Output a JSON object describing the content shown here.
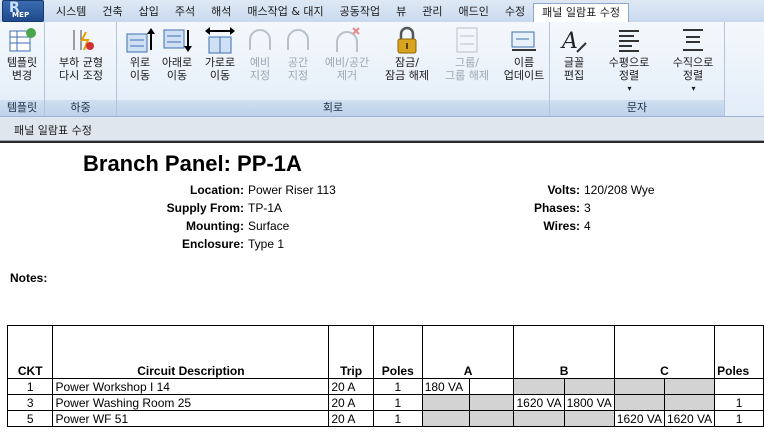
{
  "app": {
    "logo_letter": "R",
    "logo_text": "MEP"
  },
  "tabs": [
    "시스템",
    "건축",
    "삽입",
    "주석",
    "해석",
    "매스작업 & 대지",
    "공동작업",
    "뷰",
    "관리",
    "애드인",
    "수정",
    "패널 일람표 수정"
  ],
  "active_tab_index": 11,
  "ribbon": {
    "panels": [
      {
        "label": "템플릿",
        "buttons": [
          {
            "line1": "템플릿",
            "line2": "변경",
            "icon": "template-change-icon",
            "enabled": true
          }
        ]
      },
      {
        "label": "하중",
        "buttons": [
          {
            "line1": "부하 균형",
            "line2": "다시 조정",
            "icon": "rebalance-loads-icon",
            "enabled": true
          }
        ]
      },
      {
        "label": "회로",
        "buttons": [
          {
            "line1": "위로",
            "line2": "이동",
            "icon": "move-up-icon",
            "enabled": true
          },
          {
            "line1": "아래로",
            "line2": "이동",
            "icon": "move-down-icon",
            "enabled": true
          },
          {
            "line1": "가로로",
            "line2": "이동",
            "icon": "move-across-icon",
            "enabled": true
          },
          {
            "line1": "예비",
            "line2": "지정",
            "icon": "assign-spare-icon",
            "enabled": false
          },
          {
            "line1": "공간",
            "line2": "지정",
            "icon": "assign-space-icon",
            "enabled": false
          },
          {
            "line1": "예비/공간",
            "line2": "제거",
            "icon": "remove-spare-space-icon",
            "enabled": false
          },
          {
            "line1": "잠금/",
            "line2": "잠금 해제",
            "icon": "lock-icon",
            "enabled": true
          },
          {
            "line1": "그룹/",
            "line2": "그룹 해제",
            "icon": "group-icon",
            "enabled": false
          },
          {
            "line1": "이름",
            "line2": "업데이트",
            "icon": "update-names-icon",
            "enabled": true
          }
        ]
      },
      {
        "label": "문자",
        "buttons": [
          {
            "line1": "글꼴",
            "line2": "편집",
            "icon": "font-edit-icon",
            "enabled": true
          },
          {
            "line1": "수평으로",
            "line2": "정렬",
            "icon": "align-horizontal-icon",
            "enabled": true,
            "dropdown": "▾"
          },
          {
            "line1": "수직으로",
            "line2": "정렬",
            "icon": "align-vertical-icon",
            "enabled": true,
            "dropdown": "▾"
          }
        ]
      }
    ]
  },
  "context_title": "패널 일람표 수정",
  "schedule": {
    "title": "Branch Panel: PP-1A",
    "left_fields": [
      {
        "label": "Location:",
        "value": "Power Riser 113"
      },
      {
        "label": "Supply From:",
        "value": "TP-1A"
      },
      {
        "label": "Mounting:",
        "value": "Surface"
      },
      {
        "label": "Enclosure:",
        "value": "Type 1"
      }
    ],
    "right_fields": [
      {
        "label": "Volts:",
        "value": "120/208 Wye"
      },
      {
        "label": "Phases:",
        "value": "3"
      },
      {
        "label": "Wires:",
        "value": "4"
      }
    ],
    "notes_label": "Notes:",
    "headers": {
      "ckt": "CKT",
      "desc": "Circuit Description",
      "trip": "Trip",
      "poles": "Poles",
      "a": "A",
      "b": "B",
      "c": "C",
      "poles2": "Poles"
    },
    "rows": [
      {
        "ckt": "1",
        "desc": "Power Workshop I 14",
        "trip": "20 A",
        "poles": "1",
        "a1": "180 VA",
        "a2": "",
        "b1": "",
        "b2": "",
        "c1": "",
        "c2": "",
        "poles2": ""
      },
      {
        "ckt": "3",
        "desc": "Power Washing Room 25",
        "trip": "20 A",
        "poles": "1",
        "a1": "",
        "a2": "",
        "b1": "1620 VA",
        "b2": "1800 VA",
        "c1": "",
        "c2": "",
        "poles2": "1"
      },
      {
        "ckt": "5",
        "desc": "Power WF 51",
        "trip": "20 A",
        "poles": "1",
        "a1": "",
        "a2": "",
        "b1": "",
        "b2": "",
        "c1": "1620 VA",
        "c2": "1620 VA",
        "poles2": "1"
      }
    ]
  }
}
